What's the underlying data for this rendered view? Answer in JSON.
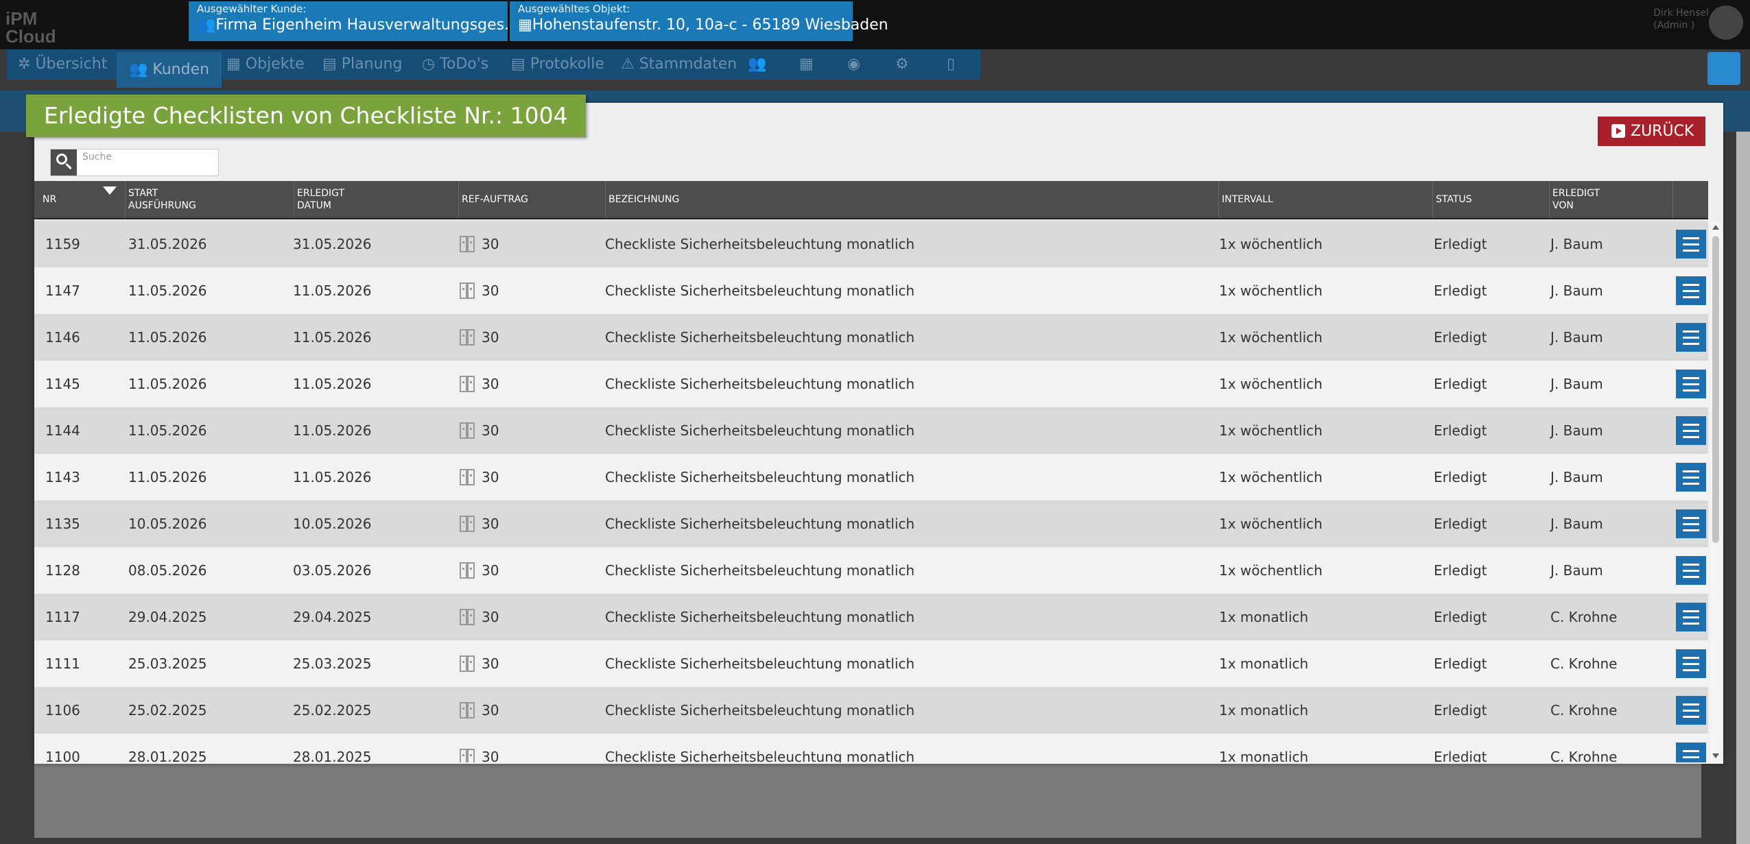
{
  "app": {
    "logo_line1": "iPM",
    "logo_line2": "Cloud"
  },
  "header": {
    "customer_label": "Ausgewählter Kunde:",
    "customer_value": "Firma Eigenheim Hausverwaltungsges. mbH",
    "object_label": "Ausgewähltes Objekt:",
    "object_value": "Hohenstaufenstr. 10, 10a-c - 65189 Wiesbaden",
    "user_name": "Dirk Hensel",
    "user_role": "(Admin )"
  },
  "nav": {
    "items": [
      {
        "label": "Übersicht"
      },
      {
        "label": "Kunden"
      },
      {
        "label": "Objekte"
      },
      {
        "label": "Planung"
      },
      {
        "label": "ToDo's"
      },
      {
        "label": "Protokolle"
      },
      {
        "label": "Stammdaten"
      }
    ]
  },
  "modal": {
    "title": "Erledigte Checklisten von Checkliste Nr.: 1004",
    "back_label": "ZURÜCK",
    "search_placeholder": "Suche"
  },
  "table": {
    "columns": {
      "nr": "NR",
      "start_l1": "START",
      "start_l2": "AUSFÜHRUNG",
      "erl_l1": "ERLEDIGT",
      "erl_l2": "DATUM",
      "ref": "REF-AUFTRAG",
      "bez": "BEZEICHNUNG",
      "int": "INTERVALL",
      "stat": "STATUS",
      "von_l1": "ERLEDIGT",
      "von_l2": "VON"
    },
    "rows": [
      {
        "nr": "1159",
        "start": "31.05.2026",
        "erledigt": "31.05.2026",
        "ref": "30",
        "bezeichnung": "Checkliste Sicherheitsbeleuchtung monatlich",
        "intervall": "1x wöchentlich",
        "status": "Erledigt",
        "von": "J. Baum"
      },
      {
        "nr": "1147",
        "start": "11.05.2026",
        "erledigt": "11.05.2026",
        "ref": "30",
        "bezeichnung": "Checkliste Sicherheitsbeleuchtung monatlich",
        "intervall": "1x wöchentlich",
        "status": "Erledigt",
        "von": "J. Baum"
      },
      {
        "nr": "1146",
        "start": "11.05.2026",
        "erledigt": "11.05.2026",
        "ref": "30",
        "bezeichnung": "Checkliste Sicherheitsbeleuchtung monatlich",
        "intervall": "1x wöchentlich",
        "status": "Erledigt",
        "von": "J. Baum"
      },
      {
        "nr": "1145",
        "start": "11.05.2026",
        "erledigt": "11.05.2026",
        "ref": "30",
        "bezeichnung": "Checkliste Sicherheitsbeleuchtung monatlich",
        "intervall": "1x wöchentlich",
        "status": "Erledigt",
        "von": "J. Baum"
      },
      {
        "nr": "1144",
        "start": "11.05.2026",
        "erledigt": "11.05.2026",
        "ref": "30",
        "bezeichnung": "Checkliste Sicherheitsbeleuchtung monatlich",
        "intervall": "1x wöchentlich",
        "status": "Erledigt",
        "von": "J. Baum"
      },
      {
        "nr": "1143",
        "start": "11.05.2026",
        "erledigt": "11.05.2026",
        "ref": "30",
        "bezeichnung": "Checkliste Sicherheitsbeleuchtung monatlich",
        "intervall": "1x wöchentlich",
        "status": "Erledigt",
        "von": "J. Baum"
      },
      {
        "nr": "1135",
        "start": "10.05.2026",
        "erledigt": "10.05.2026",
        "ref": "30",
        "bezeichnung": "Checkliste Sicherheitsbeleuchtung monatlich",
        "intervall": "1x wöchentlich",
        "status": "Erledigt",
        "von": "J. Baum"
      },
      {
        "nr": "1128",
        "start": "08.05.2026",
        "erledigt": "03.05.2026",
        "ref": "30",
        "bezeichnung": "Checkliste Sicherheitsbeleuchtung monatlich",
        "intervall": "1x wöchentlich",
        "status": "Erledigt",
        "von": "J. Baum"
      },
      {
        "nr": "1117",
        "start": "29.04.2025",
        "erledigt": "29.04.2025",
        "ref": "30",
        "bezeichnung": "Checkliste Sicherheitsbeleuchtung monatlich",
        "intervall": "1x monatlich",
        "status": "Erledigt",
        "von": "C. Krohne"
      },
      {
        "nr": "1111",
        "start": "25.03.2025",
        "erledigt": "25.03.2025",
        "ref": "30",
        "bezeichnung": "Checkliste Sicherheitsbeleuchtung monatlich",
        "intervall": "1x monatlich",
        "status": "Erledigt",
        "von": "C. Krohne"
      },
      {
        "nr": "1106",
        "start": "25.02.2025",
        "erledigt": "25.02.2025",
        "ref": "30",
        "bezeichnung": "Checkliste Sicherheitsbeleuchtung monatlich",
        "intervall": "1x monatlich",
        "status": "Erledigt",
        "von": "C. Krohne"
      },
      {
        "nr": "1100",
        "start": "28.01.2025",
        "erledigt": "28.01.2025",
        "ref": "30",
        "bezeichnung": "Checkliste Sicherheitsbeleuchtung monatlich",
        "intervall": "1x monatlich",
        "status": "Erledigt",
        "von": "C. Krohne"
      }
    ]
  },
  "colors": {
    "accent_green": "#7ba33d",
    "back_red": "#a8202a",
    "action_blue": "#1d6fae",
    "header_blue": "#1a7ab8"
  }
}
